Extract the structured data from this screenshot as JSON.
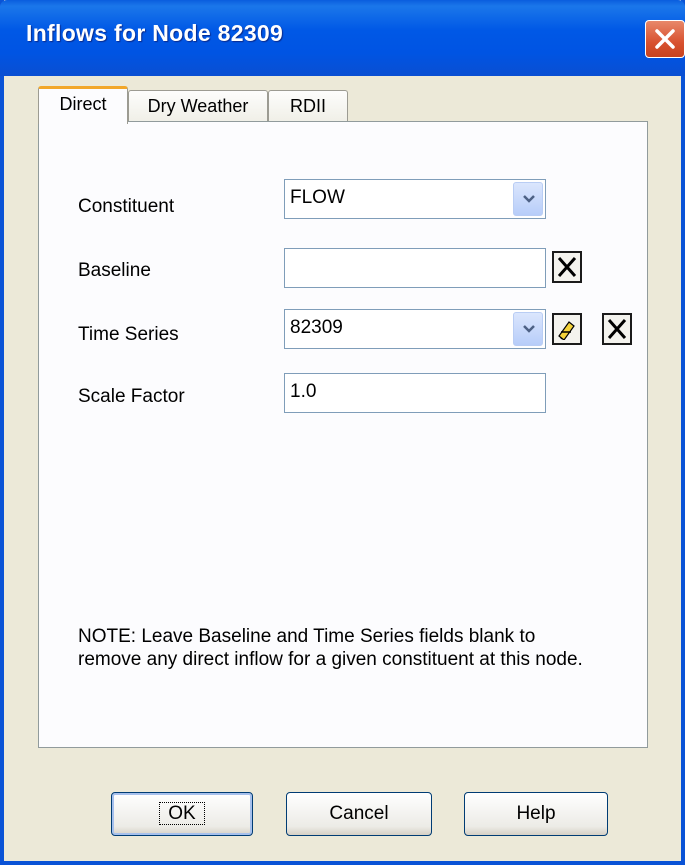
{
  "window": {
    "title": "Inflows for Node 82309"
  },
  "tabs": [
    {
      "label": "Direct"
    },
    {
      "label": "Dry Weather"
    },
    {
      "label": "RDII"
    }
  ],
  "form": {
    "constituent": {
      "label": "Constituent",
      "value": "FLOW"
    },
    "baseline": {
      "label": "Baseline",
      "value": ""
    },
    "time_series": {
      "label": "Time Series",
      "value": "82309"
    },
    "scale_factor": {
      "label": "Scale Factor",
      "value": "1.0"
    }
  },
  "note": "NOTE: Leave Baseline and Time Series fields blank to remove any direct inflow for a given constituent at this node.",
  "buttons": {
    "ok": "OK",
    "cancel": "Cancel",
    "help": "Help"
  },
  "icons": {
    "close": "close-icon",
    "dropdown": "chevron-down-icon",
    "edit": "pencil-edit-icon",
    "clear": "x-clear-icon"
  },
  "colors": {
    "titlebar": "#0054e3",
    "close": "#d8512f",
    "active_tab": "#f2a72a",
    "background": "#ece9d8"
  }
}
